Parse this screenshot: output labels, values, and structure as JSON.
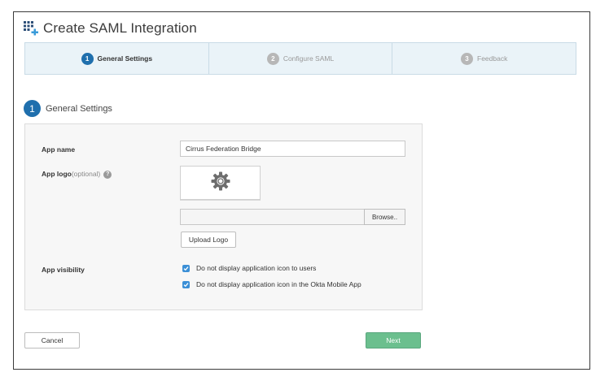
{
  "header": {
    "icon": "grid-plus-icon",
    "title": "Create SAML Integration"
  },
  "wizard": {
    "steps": [
      {
        "number": "1",
        "label": "General Settings",
        "active": true
      },
      {
        "number": "2",
        "label": "Configure SAML",
        "active": false
      },
      {
        "number": "3",
        "label": "Feedback",
        "active": false
      }
    ]
  },
  "section": {
    "number": "1",
    "title": "General Settings"
  },
  "form": {
    "app_name_label": "App name",
    "app_name_value": "Cirrus Federation Bridge",
    "app_logo_label": "App logo",
    "app_logo_optional": "(optional)",
    "help_icon": "help-icon",
    "logo_placeholder_icon": "gear-icon",
    "browse_label": "Browse..",
    "upload_logo_label": "Upload Logo",
    "app_visibility_label": "App visibility",
    "visibility_options": [
      {
        "label": "Do not display application icon to users",
        "checked": true
      },
      {
        "label": "Do not display application icon in the Okta Mobile App",
        "checked": true
      }
    ]
  },
  "footer": {
    "cancel_label": "Cancel",
    "next_label": "Next"
  },
  "colors": {
    "accent_blue": "#1f6fad",
    "wizard_bg": "#eaf3f8",
    "next_green": "#6bbf8e",
    "checkbox_blue": "#3b8fd6"
  }
}
